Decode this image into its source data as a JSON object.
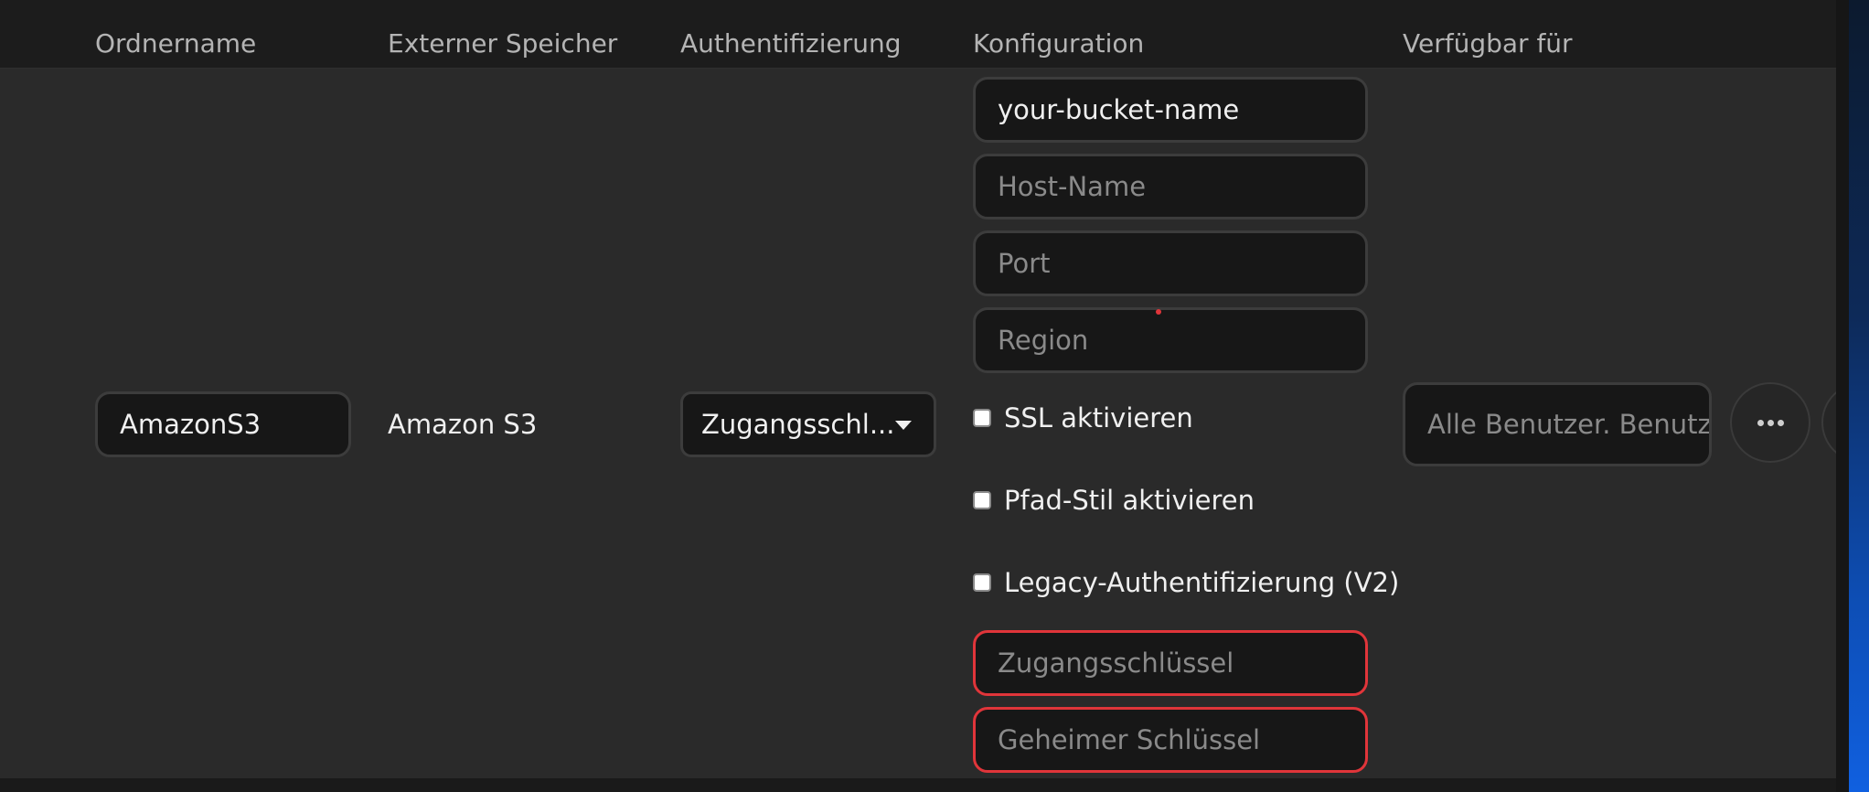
{
  "table": {
    "headers": {
      "folder_name": "Ordnername",
      "external_storage": "Externer Speicher",
      "authentication": "Authentifizierung",
      "configuration": "Konfiguration",
      "available_for": "Verfügbar für"
    }
  },
  "mount": {
    "folder_name_value": "AmazonS3",
    "storage_type": "Amazon S3",
    "auth_selected": "Zugangsschl...",
    "config": {
      "bucket_value": "your-bucket-name",
      "host_placeholder": "Host-Name",
      "port_placeholder": "Port",
      "region_placeholder": "Region",
      "ssl_label": "SSL aktivieren",
      "ssl_checked": false,
      "path_style_label": "Pfad-Stil aktivieren",
      "path_style_checked": false,
      "legacy_auth_label": "Legacy-Authentifizierung (V2)",
      "legacy_auth_checked": false,
      "access_key_placeholder": "Zugangsschlüssel",
      "secret_key_placeholder": "Geheimer Schlüssel"
    },
    "available_for_placeholder": "Alle Benutzer. Benutz",
    "more_icon": "more-horizontal-icon"
  },
  "colors": {
    "background": "#2a2a2a",
    "header_bg": "#1c1c1c",
    "input_bg": "#171717",
    "input_border": "#3c3c3c",
    "error_border": "#e0353a"
  }
}
